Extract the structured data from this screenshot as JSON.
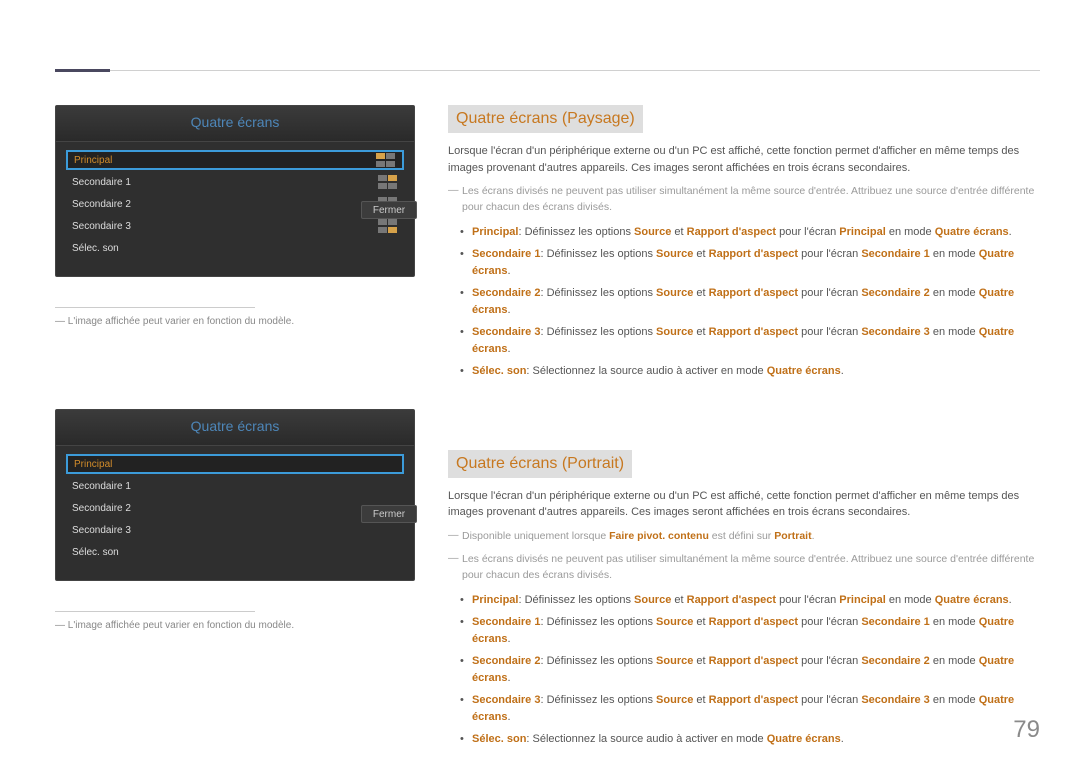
{
  "page_number": "79",
  "menu": {
    "title": "Quatre écrans",
    "items": [
      "Principal",
      "Secondaire 1",
      "Secondaire 2",
      "Secondaire 3",
      "Sélec. son"
    ],
    "close": "Fermer"
  },
  "caption": "L'image affichée peut varier en fonction du modèle.",
  "section1": {
    "heading": "Quatre écrans (Paysage)",
    "intro": "Lorsque l'écran d'un périphérique externe ou d'un PC est affiché, cette fonction permet d'afficher en même temps des images provenant d'autres appareils. Ces images seront affichées en trois écrans secondaires.",
    "note1": "Les écrans divisés ne peuvent pas utiliser simultanément la même source d'entrée. Attribuez une source d'entrée différente pour chacun des écrans divisés.",
    "b1": {
      "a": "Principal",
      "b": ": Définissez les options ",
      "c": "Source",
      "d": " et ",
      "e": "Rapport d'aspect",
      "f": " pour l'écran ",
      "g": "Principal",
      "h": " en mode ",
      "i": "Quatre écrans",
      "j": "."
    },
    "b2": {
      "a": "Secondaire 1",
      "b": ": Définissez les options ",
      "c": "Source",
      "d": " et ",
      "e": "Rapport d'aspect",
      "f": " pour l'écran ",
      "g": "Secondaire 1",
      "h": " en mode ",
      "i": "Quatre écrans",
      "j": "."
    },
    "b3": {
      "a": "Secondaire 2",
      "b": ": Définissez les options ",
      "c": "Source",
      "d": " et ",
      "e": "Rapport d'aspect",
      "f": " pour l'écran ",
      "g": "Secondaire 2",
      "h": " en mode ",
      "i": "Quatre écrans",
      "j": "."
    },
    "b4": {
      "a": "Secondaire 3",
      "b": ": Définissez les options ",
      "c": "Source",
      "d": " et ",
      "e": "Rapport d'aspect",
      "f": " pour l'écran ",
      "g": "Secondaire 3",
      "h": " en mode ",
      "i": "Quatre écrans",
      "j": "."
    },
    "b5": {
      "a": "Sélec. son",
      "b": ": Sélectionnez la source audio à activer en mode ",
      "c": "Quatre écrans",
      "d": "."
    }
  },
  "section2": {
    "heading": "Quatre écrans (Portrait)",
    "intro": "Lorsque l'écran d'un périphérique externe ou d'un PC est affiché, cette fonction permet d'afficher en même temps des images provenant d'autres appareils. Ces images seront affichées en trois écrans secondaires.",
    "noteA": {
      "a": "Disponible uniquement lorsque ",
      "b": "Faire pivot. contenu",
      "c": " est défini sur ",
      "d": "Portrait",
      "e": "."
    },
    "note1": "Les écrans divisés ne peuvent pas utiliser simultanément la même source d'entrée. Attribuez une source d'entrée différente pour chacun des écrans divisés.",
    "b1": {
      "a": "Principal",
      "b": ": Définissez les options ",
      "c": "Source",
      "d": " et ",
      "e": "Rapport d'aspect",
      "f": " pour l'écran ",
      "g": "Principal",
      "h": " en mode ",
      "i": "Quatre écrans",
      "j": "."
    },
    "b2": {
      "a": "Secondaire 1",
      "b": ": Définissez les options ",
      "c": "Source",
      "d": " et ",
      "e": "Rapport d'aspect",
      "f": " pour l'écran ",
      "g": "Secondaire 1",
      "h": " en mode ",
      "i": "Quatre écrans",
      "j": "."
    },
    "b3": {
      "a": "Secondaire 2",
      "b": ": Définissez les options ",
      "c": "Source",
      "d": " et ",
      "e": "Rapport d'aspect",
      "f": " pour l'écran ",
      "g": "Secondaire 2",
      "h": " en mode ",
      "i": "Quatre écrans",
      "j": "."
    },
    "b4": {
      "a": "Secondaire 3",
      "b": ": Définissez les options ",
      "c": "Source",
      "d": " et ",
      "e": "Rapport d'aspect",
      "f": " pour l'écran ",
      "g": "Secondaire 3",
      "h": " en mode ",
      "i": "Quatre écrans",
      "j": "."
    },
    "b5": {
      "a": "Sélec. son",
      "b": ": Sélectionnez la source audio à activer en mode ",
      "c": "Quatre écrans",
      "d": "."
    }
  }
}
